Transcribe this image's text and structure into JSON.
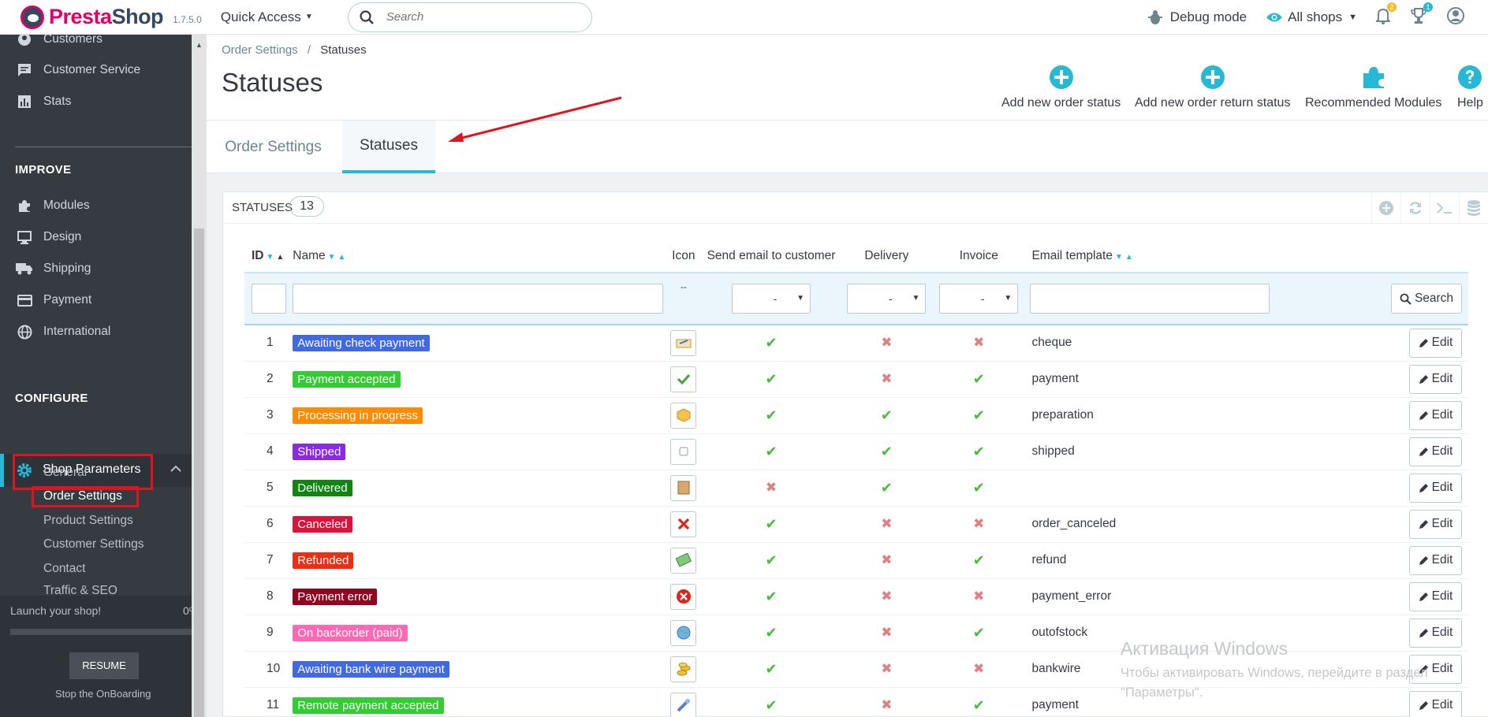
{
  "header": {
    "brand_presta": "Presta",
    "brand_shop": "Shop",
    "version": "1.7.5.0",
    "quick_access": "Quick Access",
    "search_placeholder": "Search",
    "debug_mode": "Debug mode",
    "all_shops": "All shops",
    "notifications_count": "2",
    "trophy_count": "1"
  },
  "sidebar": {
    "items_top": [
      {
        "label": "Customers",
        "icon": "person-icon"
      },
      {
        "label": "Customer Service",
        "icon": "chat-icon"
      },
      {
        "label": "Stats",
        "icon": "bar-chart-icon"
      }
    ],
    "improve_title": "IMPROVE",
    "improve_items": [
      {
        "label": "Modules",
        "icon": "puzzle-icon"
      },
      {
        "label": "Design",
        "icon": "monitor-icon"
      },
      {
        "label": "Shipping",
        "icon": "truck-icon"
      },
      {
        "label": "Payment",
        "icon": "card-icon"
      },
      {
        "label": "International",
        "icon": "globe-icon"
      }
    ],
    "configure_title": "CONFIGURE",
    "shop_parameters": "Shop Parameters",
    "sub_items": [
      "General",
      "Order Settings",
      "Product Settings",
      "Customer Settings",
      "Contact",
      "Traffic & SEO"
    ],
    "launch_text": "Launch your shop!",
    "launch_pct": "0%",
    "resume": "RESUME",
    "stop_onboarding": "Stop the OnBoarding"
  },
  "toolbar": {
    "breadcrumb_parent": "Order Settings",
    "breadcrumb_sep": "/",
    "breadcrumb_current": "Statuses",
    "title": "Statuses",
    "buttons": {
      "add_order_status": "Add new order status",
      "add_return_status": "Add new order return status",
      "recommended_modules": "Recommended Modules",
      "help": "Help"
    }
  },
  "tabs": {
    "order_settings": "Order Settings",
    "statuses": "Statuses"
  },
  "panel": {
    "title": "STATUSES",
    "count": "13"
  },
  "table": {
    "headers": {
      "id": "ID",
      "name": "Name",
      "icon": "Icon",
      "send_email": "Send email to customer",
      "delivery": "Delivery",
      "invoice": "Invoice",
      "email_template": "Email template"
    },
    "filter": {
      "icon_placeholder": "--",
      "send_email_value": "-",
      "delivery_value": "-",
      "invoice_value": "-",
      "search_button": "Search"
    },
    "edit_label": "Edit",
    "rows": [
      {
        "id": "1",
        "name": "Awaiting check payment",
        "color": "#4169e1",
        "icon": "check-document-icon",
        "send_email": true,
        "delivery": false,
        "invoice": false,
        "template": "cheque"
      },
      {
        "id": "2",
        "name": "Payment accepted",
        "color": "#32cd32",
        "icon": "green-check-icon",
        "send_email": true,
        "delivery": false,
        "invoice": true,
        "template": "payment"
      },
      {
        "id": "3",
        "name": "Processing in progress",
        "color": "#ff8c00",
        "icon": "box-icon",
        "send_email": true,
        "delivery": true,
        "invoice": true,
        "template": "preparation"
      },
      {
        "id": "4",
        "name": "Shipped",
        "color": "#8a2be2",
        "icon": "blank-icon",
        "send_email": true,
        "delivery": true,
        "invoice": true,
        "template": "shipped"
      },
      {
        "id": "5",
        "name": "Delivered",
        "color": "#108510",
        "icon": "package-icon",
        "send_email": false,
        "delivery": true,
        "invoice": true,
        "template": ""
      },
      {
        "id": "6",
        "name": "Canceled",
        "color": "#dc143c",
        "icon": "red-cross-icon",
        "send_email": true,
        "delivery": false,
        "invoice": false,
        "template": "order_canceled"
      },
      {
        "id": "7",
        "name": "Refunded",
        "color": "#ec2e15",
        "icon": "money-icon",
        "send_email": true,
        "delivery": false,
        "invoice": true,
        "template": "refund"
      },
      {
        "id": "8",
        "name": "Payment error",
        "color": "#8f0621",
        "icon": "error-icon",
        "send_email": true,
        "delivery": false,
        "invoice": false,
        "template": "payment_error"
      },
      {
        "id": "9",
        "name": "On backorder (paid)",
        "color": "#ff69b4",
        "icon": "globe-refresh-icon",
        "send_email": true,
        "delivery": false,
        "invoice": true,
        "template": "outofstock"
      },
      {
        "id": "10",
        "name": "Awaiting bank wire payment",
        "color": "#4169e1",
        "icon": "coins-icon",
        "send_email": true,
        "delivery": false,
        "invoice": false,
        "template": "bankwire"
      },
      {
        "id": "11",
        "name": "Remote payment accepted",
        "color": "#32cd32",
        "icon": "remote-pay-icon",
        "send_email": true,
        "delivery": false,
        "invoice": true,
        "template": "payment"
      }
    ]
  },
  "watermark": {
    "line1": "Активация Windows",
    "line2": "Чтобы активировать Windows, перейдите в раздел",
    "line3": "\"Параметры\"."
  }
}
